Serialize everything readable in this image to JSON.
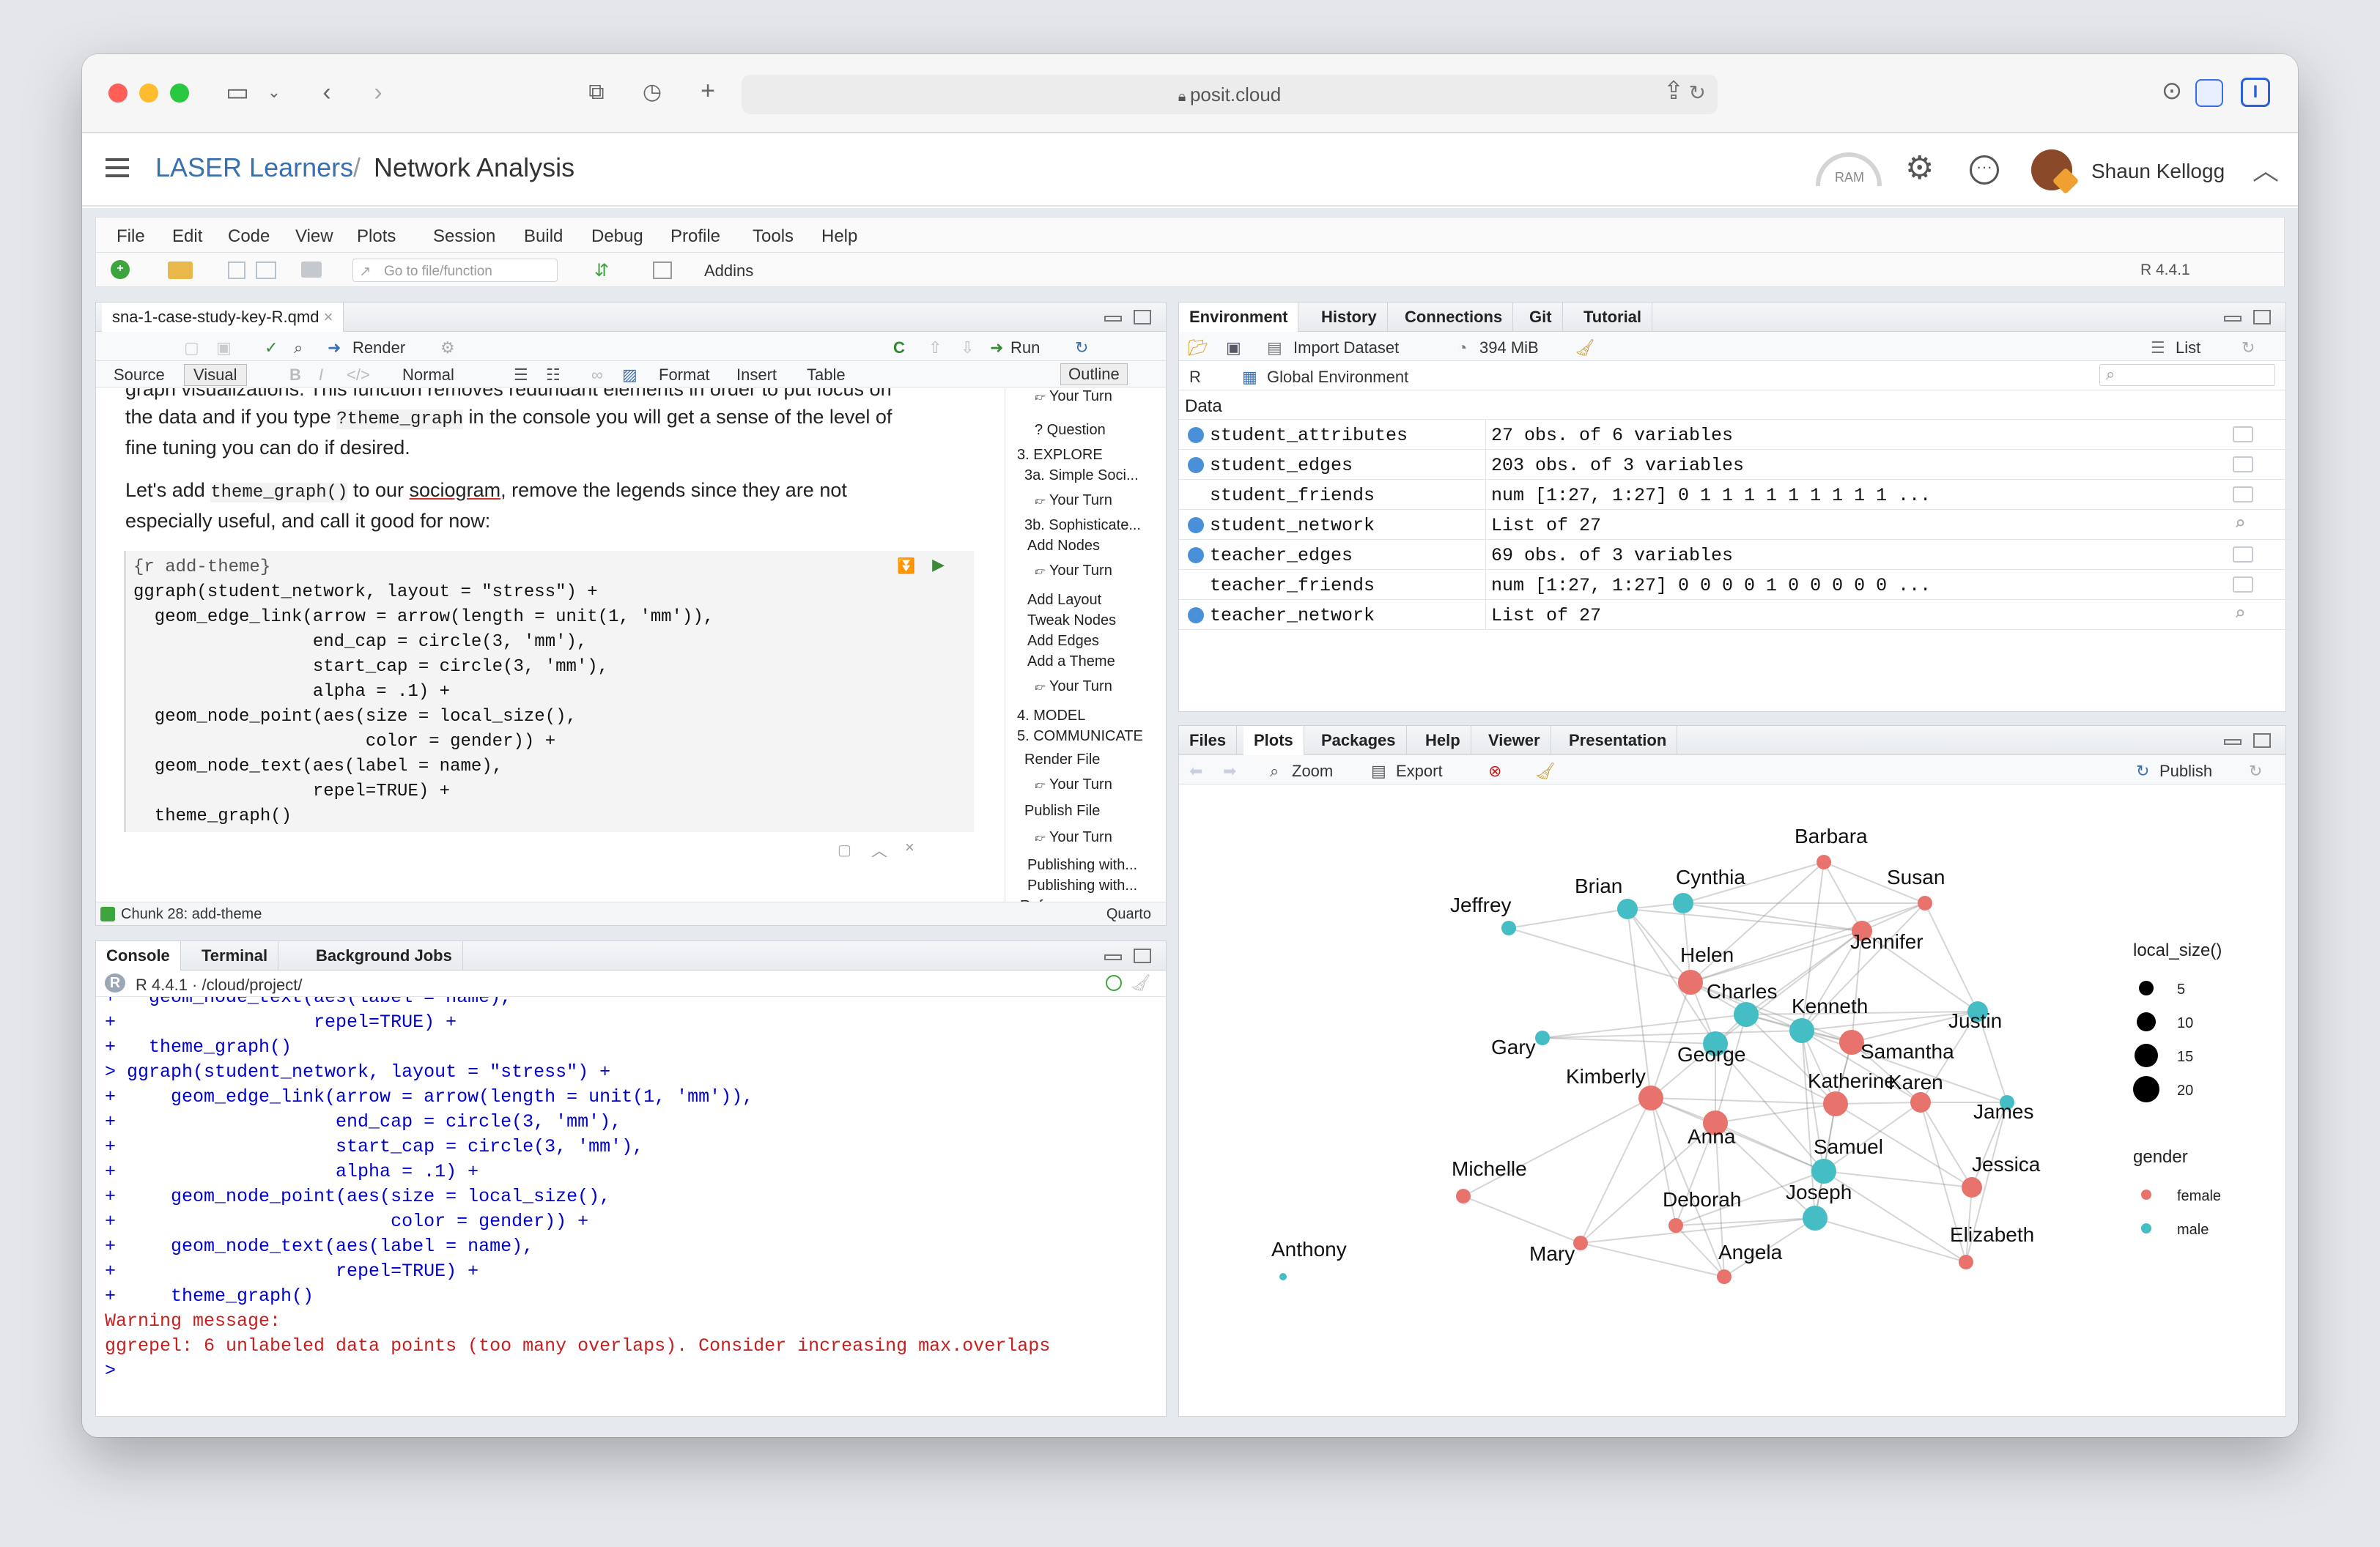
{
  "browser": {
    "url": "posit.cloud"
  },
  "app": {
    "breadcrumb_workspace": "LASER Learners",
    "breadcrumb_sep": "/",
    "project_title": "Network Analysis",
    "ram_label": "RAM",
    "user_name": "Shaun Kellogg"
  },
  "menu": [
    "File",
    "Edit",
    "Code",
    "View",
    "Plots",
    "Session",
    "Build",
    "Debug",
    "Profile",
    "Tools",
    "Help"
  ],
  "toolbar": {
    "goto_placeholder": "Go to file/function",
    "addins": "Addins",
    "r_version": "R 4.4.1"
  },
  "editor": {
    "file_tab": "sna-1-case-study-key-R.qmd",
    "render": "Render",
    "run": "Run",
    "source": "Source",
    "visual": "Visual",
    "normal": "Normal",
    "format": "Format",
    "insert": "Insert",
    "table": "Table",
    "outline": "Outline",
    "para_top": "graph visualizations. This function removes redundant elements in order to put focus on",
    "para1_a": "the data and if you type ",
    "para1_code": "?theme_graph",
    "para1_b": " in the console you will get a sense of the level of",
    "para1_c": "fine tuning you can do if desired.",
    "para2_a": "Let's add ",
    "para2_code": "theme_graph()",
    "para2_b": " to our ",
    "para2_link": "sociogram",
    "para2_c": ", remove the legends since they are not",
    "para2_d": "especially useful, and call it good for now:",
    "chunk_header": "{r add-theme}",
    "code_lines": [
      "ggraph(student_network, layout = \"stress\") +",
      "  geom_edge_link(arrow = arrow(length = unit(1, 'mm')),",
      "                 end_cap = circle(3, 'mm'),",
      "                 start_cap = circle(3, 'mm'),",
      "                 alpha = .1) +",
      "  geom_node_point(aes(size = local_size(),",
      "                      color = gender)) +",
      "  geom_node_text(aes(label = name),",
      "                 repel=TRUE) +",
      "  theme_graph()"
    ],
    "status_chunk": "Chunk 28: add-theme",
    "status_mode": "Quarto",
    "outline_items": [
      "Your Turn",
      "3. EXPLORE",
      "3a. Simple Soci...",
      "Your Turn",
      "3b. Sophisticate...",
      "Add Nodes",
      "Your Turn",
      "Add Layout",
      "Tweak Nodes",
      "Add Edges",
      "Add a Theme",
      "Your Turn",
      "4. MODEL",
      "5. COMMUNICATE",
      "Render File",
      "Your Turn",
      "Publish File",
      "Your Turn",
      "Publishing with...",
      "Publishing with...",
      "References"
    ],
    "outline_question": "Question"
  },
  "console": {
    "tabs": [
      "Console",
      "Terminal",
      "Background Jobs"
    ],
    "r_info": "R 4.4.1 · /cloud/project/",
    "lines": [
      "+   geom_node_text(aes(label = name),",
      "+                  repel=TRUE) +",
      "+   theme_graph()",
      "> ggraph(student_network, layout = \"stress\") +",
      "+     geom_edge_link(arrow = arrow(length = unit(1, 'mm')),",
      "+                    end_cap = circle(3, 'mm'),",
      "+                    start_cap = circle(3, 'mm'),",
      "+                    alpha = .1) +",
      "+     geom_node_point(aes(size = local_size(),",
      "+                         color = gender)) +",
      "+     geom_node_text(aes(label = name),",
      "+                    repel=TRUE) +",
      "+     theme_graph()"
    ],
    "warning1": "Warning message:",
    "warning2": "ggrepel: 6 unlabeled data points (too many overlaps). Consider increasing max.overlaps",
    "prompt": ">"
  },
  "environment": {
    "tabs": [
      "Environment",
      "History",
      "Connections",
      "Git",
      "Tutorial"
    ],
    "import_dataset": "Import Dataset",
    "memory": "394 MiB",
    "list_view": "List",
    "lang": "R",
    "scope": "Global Environment",
    "section": "Data",
    "rows": [
      {
        "name": "student_attributes",
        "value": "27 obs. of 6 variables",
        "expand": true,
        "icon": "table"
      },
      {
        "name": "student_edges",
        "value": "203 obs. of 3 variables",
        "expand": true,
        "icon": "table"
      },
      {
        "name": "student_friends",
        "value": "num [1:27, 1:27] 0 1 1 1 1 1 1 1 1 1 ...",
        "expand": false,
        "icon": "table"
      },
      {
        "name": "student_network",
        "value": "List of  27",
        "expand": true,
        "icon": "search"
      },
      {
        "name": "teacher_edges",
        "value": "69 obs. of 3 variables",
        "expand": true,
        "icon": "table"
      },
      {
        "name": "teacher_friends",
        "value": "num [1:27, 1:27] 0 0 0 0 1 0 0 0 0 0 ...",
        "expand": false,
        "icon": "table"
      },
      {
        "name": "teacher_network",
        "value": "List of  27",
        "expand": true,
        "icon": "search"
      }
    ]
  },
  "files_pane": {
    "tabs": [
      "Files",
      "Plots",
      "Packages",
      "Help",
      "Viewer",
      "Presentation"
    ],
    "zoom": "Zoom",
    "export": "Export",
    "publish": "Publish"
  },
  "plot": {
    "legend_size_title": "local_size()",
    "legend_sizes": [
      "5",
      "10",
      "15",
      "20"
    ],
    "legend_gender_title": "gender",
    "legend_genders": [
      "female",
      "male"
    ],
    "colors": {
      "female": "#e8736c",
      "male": "#45bdc4"
    },
    "nodes": [
      {
        "name": "Barbara",
        "gender": "female",
        "size": 5
      },
      {
        "name": "Cynthia",
        "gender": "male",
        "size": 10
      },
      {
        "name": "Brian",
        "gender": "male",
        "size": 10
      },
      {
        "name": "Susan",
        "gender": "female",
        "size": 5
      },
      {
        "name": "Jeffrey",
        "gender": "male",
        "size": 5
      },
      {
        "name": "Jennifer",
        "gender": "female",
        "size": 10
      },
      {
        "name": "Helen",
        "gender": "female",
        "size": 15
      },
      {
        "name": "Charles",
        "gender": "male",
        "size": 15
      },
      {
        "name": "Kenneth",
        "gender": "male",
        "size": 15
      },
      {
        "name": "Justin",
        "gender": "male",
        "size": 10
      },
      {
        "name": "Gary",
        "gender": "male",
        "size": 5
      },
      {
        "name": "George",
        "gender": "male",
        "size": 15
      },
      {
        "name": "Samantha",
        "gender": "female",
        "size": 15
      },
      {
        "name": "Kimberly",
        "gender": "female",
        "size": 15
      },
      {
        "name": "Katherine",
        "gender": "female",
        "size": 15
      },
      {
        "name": "Karen",
        "gender": "female",
        "size": 10
      },
      {
        "name": "James",
        "gender": "male",
        "size": 5
      },
      {
        "name": "Anna",
        "gender": "female",
        "size": 15
      },
      {
        "name": "Samuel",
        "gender": "male",
        "size": 15
      },
      {
        "name": "Michelle",
        "gender": "female",
        "size": 5
      },
      {
        "name": "Jessica",
        "gender": "female",
        "size": 10
      },
      {
        "name": "Deborah",
        "gender": "female",
        "size": 5
      },
      {
        "name": "Joseph",
        "gender": "male",
        "size": 15
      },
      {
        "name": "Mary",
        "gender": "female",
        "size": 5
      },
      {
        "name": "Elizabeth",
        "gender": "female",
        "size": 5
      },
      {
        "name": "Angela",
        "gender": "female",
        "size": 5
      },
      {
        "name": "Anthony",
        "gender": "male",
        "size": 3
      }
    ]
  }
}
